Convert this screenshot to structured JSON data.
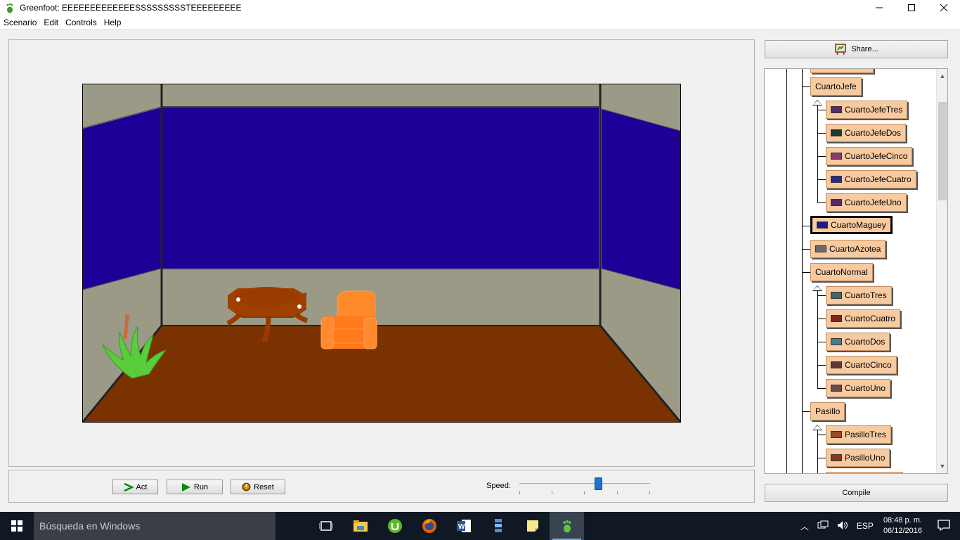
{
  "window": {
    "title": "Greenfoot: EEEEEEEEEEEEESSSSSSSSSTEEEEEEEEE"
  },
  "menu": [
    "Scenario",
    "Edit",
    "Controls",
    "Help"
  ],
  "controls": {
    "act_label": "Act",
    "run_label": "Run",
    "reset_label": "Reset",
    "speed_label": "Speed:",
    "speed_value": 0.6
  },
  "share_label": "Share...",
  "compile_label": "Compile",
  "class_tree": {
    "classes": [
      {
        "name": "CuartoJefe",
        "thumb": "#1a1a8a"
      },
      {
        "name": "CuartoJefeTres",
        "thumb": "#5a2a6a"
      },
      {
        "name": "CuartoJefeDos",
        "thumb": "#1a3a2a"
      },
      {
        "name": "CuartoJefeCinco",
        "thumb": "#8a3a6a"
      },
      {
        "name": "CuartoJefeCuatro",
        "thumb": "#2a2a8a"
      },
      {
        "name": "CuartoJefeUno",
        "thumb": "#5a2a6a"
      },
      {
        "name": "CuartoMaguey",
        "thumb": "#1a1a8a"
      },
      {
        "name": "CuartoAzotea",
        "thumb": "#6a6a6a"
      },
      {
        "name": "CuartoNormal",
        "thumb": "#888888"
      },
      {
        "name": "CuartoTres",
        "thumb": "#3a6a6a"
      },
      {
        "name": "CuartoCuatro",
        "thumb": "#7a2a1a"
      },
      {
        "name": "CuartoDos",
        "thumb": "#4a7a8a"
      },
      {
        "name": "CuartoCinco",
        "thumb": "#5a3a3a"
      },
      {
        "name": "CuartoUno",
        "thumb": "#6a4a4a"
      },
      {
        "name": "Pasillo",
        "thumb": "#f8caa0"
      },
      {
        "name": "PasilloTres",
        "thumb": "#9a4a2a"
      },
      {
        "name": "PasilloUno",
        "thumb": "#8a3a1a"
      }
    ]
  },
  "taskbar": {
    "search_placeholder": "Búsqueda en Windows",
    "language": "ESP",
    "time": "08:48 p. m.",
    "date": "06/12/2016"
  },
  "colors": {
    "wall_blue": "#1e0096",
    "wall_gray": "#9a9a86",
    "floor": "#7a3300",
    "class_fill": "#f8caa0"
  }
}
